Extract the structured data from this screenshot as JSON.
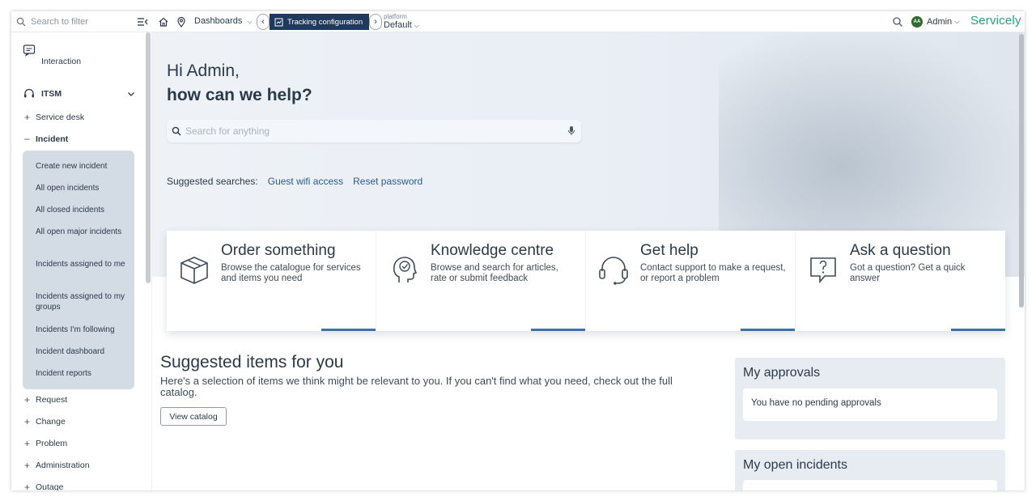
{
  "topbar": {
    "filter_placeholder": "Search to filter",
    "dashboards_label": "Dashboards",
    "tracking_label": "Tracking configuration",
    "platform_caption": "platform",
    "platform_value": "Default",
    "avatar_initials": "AA",
    "user_label": "Admin",
    "brand": "Servicely"
  },
  "sidebar": {
    "interaction": "Interaction",
    "itsm": "ITSM",
    "service_desk": "Service desk",
    "incident": "Incident",
    "incident_items": [
      "Create new incident",
      "All open incidents",
      "All closed incidents",
      "All open major incidents",
      "Incidents assigned to me",
      "Incidents assigned to my groups",
      "Incidents I'm following",
      "Incident dashboard",
      "Incident reports"
    ],
    "request": "Request",
    "change": "Change",
    "problem": "Problem",
    "administration": "Administration",
    "outage": "Outage"
  },
  "hero": {
    "greeting": "Hi Admin,",
    "question": "how can we help?",
    "search_placeholder": "Search for anything",
    "suggested_label": "Suggested searches:",
    "suggested": [
      "Guest wifi access",
      "Reset password"
    ]
  },
  "cards": [
    {
      "title": "Order something",
      "desc": "Browse the catalogue for services and items you need",
      "icon": "box-icon"
    },
    {
      "title": "Knowledge centre",
      "desc": "Browse and search for articles, rate or submit feedback",
      "icon": "head-check-icon"
    },
    {
      "title": "Get help",
      "desc": "Contact support to make a request, or report a problem",
      "icon": "headset-icon"
    },
    {
      "title": "Ask a question",
      "desc": "Got a question? Get a quick answer",
      "icon": "question-bubble-icon"
    }
  ],
  "suggested_items": {
    "title": "Suggested items for you",
    "text": "Here's a selection of items we think might be relevant to you. If you can't find what you need, check out the full catalog.",
    "button": "View catalog"
  },
  "approvals": {
    "title": "My approvals",
    "empty": "You have no pending approvals"
  },
  "open_incidents": {
    "title": "My open incidents"
  },
  "colors": {
    "accent": "#3b73a9",
    "nav_dark": "#1f3a5c",
    "brand": "#25a27a",
    "submenu_bg": "#d3dbe5"
  }
}
